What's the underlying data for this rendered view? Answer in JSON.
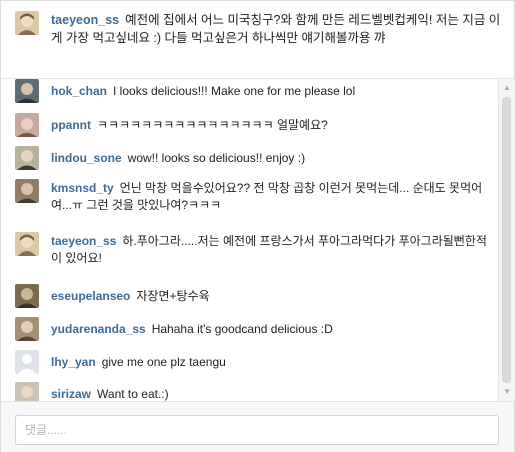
{
  "caption": {
    "username": "taeyeon_ss",
    "text": "예전에 집에서 어느 미국칭구?와 함께 만든 레드벨벳컵케익! 저는 지금 이게 가장 먹고싶네요 :) 다들 먹고싶은거 하나씩만 얘기해볼까용 꺄"
  },
  "comments": [
    {
      "username": "hok_chan",
      "text": "I looks delicious!!! Make one for me please lol"
    },
    {
      "username": "ppannt",
      "text": "ㅋㅋㅋㅋㅋㅋㅋㅋㅋㅋㅋㅋㅋㅋㅋㅋ 얼말예요?"
    },
    {
      "username": "lindou_sone",
      "text": "wow!! looks so delicious!! enjoy :)"
    },
    {
      "username": "kmsnsd_ty",
      "text": "언닌 막창 먹을수있어요?? 전 막창 곱창 이런거 못먹는데... 순대도 못먹어여...ㅠ 그런 것을 맛있나여?ㅋㅋㅋ"
    },
    {
      "username": "taeyeon_ss",
      "text": "하.푸아그라.....저는 예전에 프랑스가서 푸아그라먹다가 푸아그라될뻔한적이 있어요!"
    },
    {
      "username": "eseupelanseo",
      "text": "자장면+탕수육"
    },
    {
      "username": "yudarenanda_ss",
      "text": "Hahaha it's goodcand delicious :D"
    },
    {
      "username": "lhy_yan",
      "text": "give me one plz taengu"
    },
    {
      "username": "sirizaw",
      "text": "Want to eat.:)"
    }
  ],
  "input": {
    "placeholder": "댓글......"
  },
  "scrollbar": {
    "up": "▲",
    "down": "▼"
  }
}
